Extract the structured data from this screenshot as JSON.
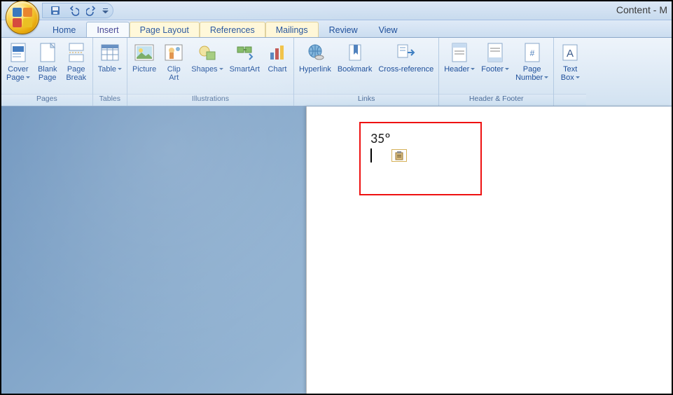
{
  "window": {
    "title": "Content - M"
  },
  "qat": {
    "save": "save",
    "undo": "undo",
    "redo": "redo"
  },
  "tabs": [
    {
      "id": "home",
      "label": "Home",
      "state": "normal"
    },
    {
      "id": "insert",
      "label": "Insert",
      "state": "active"
    },
    {
      "id": "page-layout",
      "label": "Page Layout",
      "state": "hl"
    },
    {
      "id": "references",
      "label": "References",
      "state": "hl"
    },
    {
      "id": "mailings",
      "label": "Mailings",
      "state": "hl"
    },
    {
      "id": "review",
      "label": "Review",
      "state": "normal"
    },
    {
      "id": "view",
      "label": "View",
      "state": "normal"
    }
  ],
  "ribbon": {
    "groups": {
      "pages": {
        "label": "Pages",
        "items": {
          "cover": "Cover\nPage",
          "blank": "Blank\nPage",
          "break": "Page\nBreak"
        }
      },
      "tables": {
        "label": "Tables",
        "items": {
          "table": "Table"
        }
      },
      "illustrations": {
        "label": "Illustrations",
        "items": {
          "picture": "Picture",
          "clipart": "Clip\nArt",
          "shapes": "Shapes",
          "smartart": "SmartArt",
          "chart": "Chart"
        }
      },
      "links": {
        "label": "Links",
        "items": {
          "hyperlink": "Hyperlink",
          "bookmark": "Bookmark",
          "crossref": "Cross-reference"
        }
      },
      "headerfooter": {
        "label": "Header & Footer",
        "items": {
          "header": "Header",
          "footer": "Footer",
          "pagenum": "Page\nNumber"
        }
      },
      "text": {
        "label": "",
        "items": {
          "textbox": "Text\nBox"
        }
      }
    }
  },
  "document": {
    "content": "35º"
  }
}
